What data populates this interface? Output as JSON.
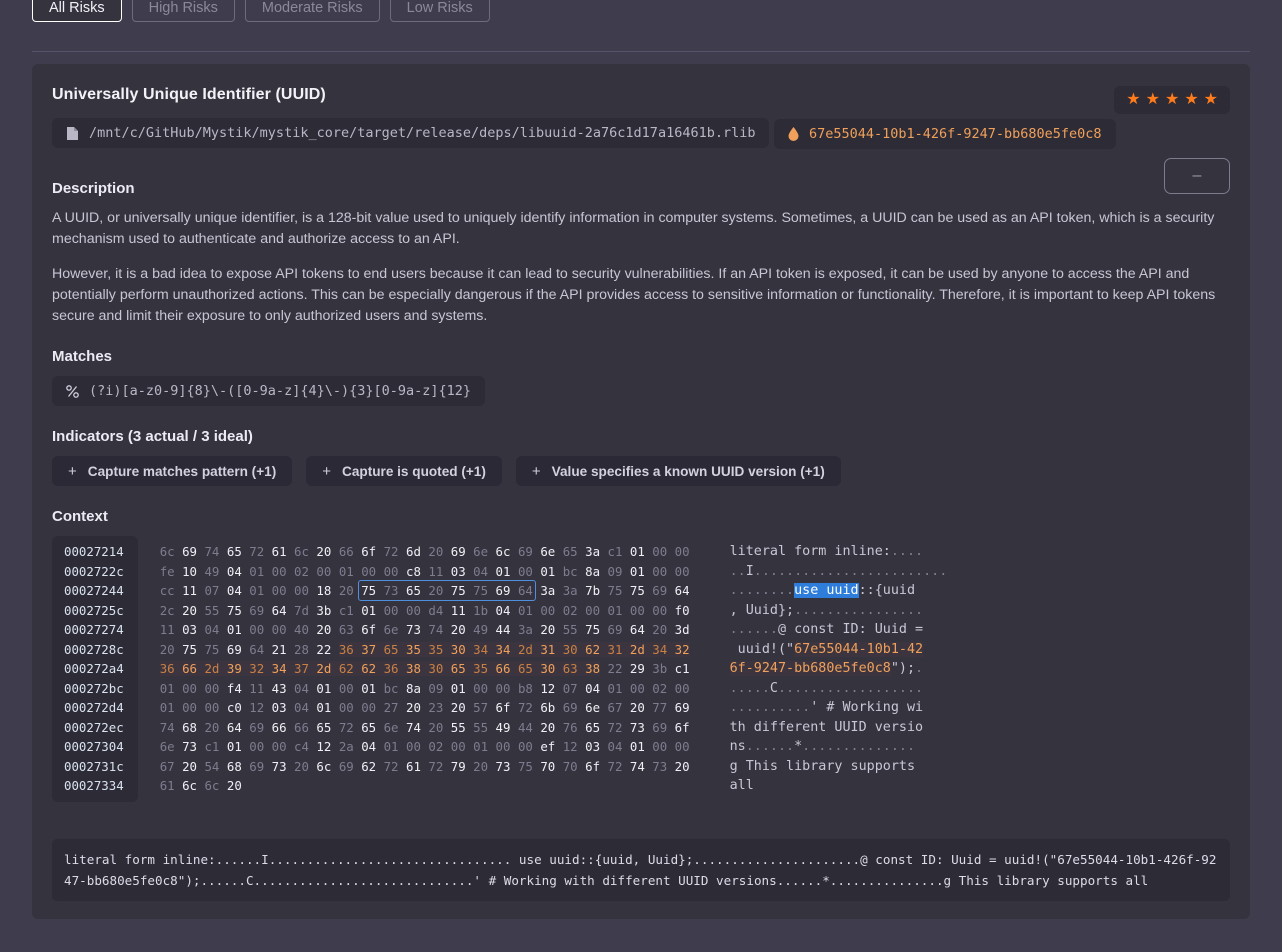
{
  "tabs": [
    {
      "label": "All Risks",
      "active": true
    },
    {
      "label": "High Risks",
      "active": false
    },
    {
      "label": "Moderate Risks",
      "active": false
    },
    {
      "label": "Low Risks",
      "active": false
    }
  ],
  "card": {
    "title": "Universally Unique Identifier (UUID)",
    "file_path": "/mnt/c/GitHub/Mystik/mystik_core/target/release/deps/libuuid-2a76c1d17a16461b.rlib",
    "hash": "67e55044-10b1-426f-9247-bb680e5fe0c8",
    "path_icon": "file-icon",
    "hash_icon": "droplet-icon",
    "rating": 5,
    "star_glyph": "★",
    "star_color": "#ff7b1c",
    "minimize_label": "–"
  },
  "description": {
    "heading": "Description",
    "paragraphs": [
      "A UUID, or universally unique identifier, is a 128-bit value used to uniquely identify information in computer systems. Sometimes, a UUID can be used as an API token, which is a security mechanism used to authenticate and authorize access to an API.",
      "However, it is a bad idea to expose API tokens to end users because it can lead to security vulnerabilities. If an API token is exposed, it can be used by anyone to access the API and potentially perform unauthorized actions. This can be especially dangerous if the API provides access to sensitive information or functionality. Therefore, it is important to keep API tokens secure and limit their exposure to only authorized users and systems."
    ]
  },
  "matches": {
    "heading": "Matches",
    "icon": "regex-icon",
    "pattern": "(?i)[a-z0-9]{8}\\-([0-9a-z]{4}\\-){3}[0-9a-z]{12}"
  },
  "indicators": {
    "heading": "Indicators (3 actual / 3 ideal)",
    "plus_glyph": "+",
    "items": [
      "Capture matches pattern (+1)",
      "Capture is quoted (+1)",
      "Value specifies a known UUID version (+1)"
    ]
  },
  "context": {
    "heading": "Context",
    "offsets": [
      "00027214",
      "0002722c",
      "00027244",
      "0002725c",
      "00027274",
      "0002728c",
      "000272a4",
      "000272bc",
      "000272d4",
      "000272ec",
      "00027304",
      "0002731c",
      "00027334"
    ],
    "rows": [
      [
        "6c",
        "69",
        "74",
        "65",
        "72",
        "61",
        "6c",
        "20",
        "66",
        "6f",
        "72",
        "6d",
        "20",
        "69",
        "6e",
        "6c",
        "69",
        "6e",
        "65",
        "3a",
        "c1",
        "01",
        "00",
        "00"
      ],
      [
        "fe",
        "10",
        "49",
        "04",
        "01",
        "00",
        "02",
        "00",
        "01",
        "00",
        "00",
        "c8",
        "11",
        "03",
        "04",
        "01",
        "00",
        "01",
        "bc",
        "8a",
        "09",
        "01",
        "00",
        "00"
      ],
      [
        "cc",
        "11",
        "07",
        "04",
        "01",
        "00",
        "00",
        "18",
        "20",
        "75",
        "73",
        "65",
        "20",
        "75",
        "75",
        "69",
        "64",
        "3a",
        "3a",
        "7b",
        "75",
        "75",
        "69",
        "64"
      ],
      [
        "2c",
        "20",
        "55",
        "75",
        "69",
        "64",
        "7d",
        "3b",
        "c1",
        "01",
        "00",
        "00",
        "d4",
        "11",
        "1b",
        "04",
        "01",
        "00",
        "02",
        "00",
        "01",
        "00",
        "00",
        "f0"
      ],
      [
        "11",
        "03",
        "04",
        "01",
        "00",
        "00",
        "40",
        "20",
        "63",
        "6f",
        "6e",
        "73",
        "74",
        "20",
        "49",
        "44",
        "3a",
        "20",
        "55",
        "75",
        "69",
        "64",
        "20",
        "3d"
      ],
      [
        "20",
        "75",
        "75",
        "69",
        "64",
        "21",
        "28",
        "22",
        "36",
        "37",
        "65",
        "35",
        "35",
        "30",
        "34",
        "34",
        "2d",
        "31",
        "30",
        "62",
        "31",
        "2d",
        "34",
        "32"
      ],
      [
        "36",
        "66",
        "2d",
        "39",
        "32",
        "34",
        "37",
        "2d",
        "62",
        "62",
        "36",
        "38",
        "30",
        "65",
        "35",
        "66",
        "65",
        "30",
        "63",
        "38",
        "22",
        "29",
        "3b",
        "c1"
      ],
      [
        "01",
        "00",
        "00",
        "f4",
        "11",
        "43",
        "04",
        "01",
        "00",
        "01",
        "bc",
        "8a",
        "09",
        "01",
        "00",
        "00",
        "b8",
        "12",
        "07",
        "04",
        "01",
        "00",
        "02",
        "00"
      ],
      [
        "01",
        "00",
        "00",
        "c0",
        "12",
        "03",
        "04",
        "01",
        "00",
        "00",
        "27",
        "20",
        "23",
        "20",
        "57",
        "6f",
        "72",
        "6b",
        "69",
        "6e",
        "67",
        "20",
        "77",
        "69"
      ],
      [
        "74",
        "68",
        "20",
        "64",
        "69",
        "66",
        "66",
        "65",
        "72",
        "65",
        "6e",
        "74",
        "20",
        "55",
        "55",
        "49",
        "44",
        "20",
        "76",
        "65",
        "72",
        "73",
        "69",
        "6f"
      ],
      [
        "6e",
        "73",
        "c1",
        "01",
        "00",
        "00",
        "c4",
        "12",
        "2a",
        "04",
        "01",
        "00",
        "02",
        "00",
        "01",
        "00",
        "00",
        "ef",
        "12",
        "03",
        "04",
        "01",
        "00",
        "00"
      ],
      [
        "67",
        "20",
        "54",
        "68",
        "69",
        "73",
        "20",
        "6c",
        "69",
        "62",
        "72",
        "61",
        "72",
        "79",
        "20",
        "73",
        "75",
        "70",
        "70",
        "6f",
        "72",
        "74",
        "73",
        "20"
      ],
      [
        "61",
        "6c",
        "6c",
        "20"
      ]
    ],
    "selection_row": 2,
    "selection_start": 9,
    "selection_end": 16,
    "orange_row_start": 5,
    "orange_start_col": 8,
    "orange_row_end": 6,
    "orange_end_col": 19,
    "ascii_lines": [
      [
        {
          "t": "literal form inline:",
          "s": "n"
        },
        {
          "t": "....",
          "s": "d"
        }
      ],
      [
        {
          "t": "..",
          "s": "d"
        },
        {
          "t": "I",
          "s": "n"
        },
        {
          "t": "........................",
          "s": "d"
        }
      ],
      [
        {
          "t": "........",
          "s": "d"
        },
        {
          "t": "use uuid",
          "s": "sel"
        },
        {
          "t": "::{uuid",
          "s": "n"
        }
      ],
      [
        {
          "t": ", Uuid};",
          "s": "n"
        },
        {
          "t": "................",
          "s": "d"
        }
      ],
      [
        {
          "t": "......",
          "s": "d"
        },
        {
          "t": "@ const ID: Uuid =",
          "s": "n"
        }
      ],
      [
        {
          "t": " uuid!(\"",
          "s": "n"
        },
        {
          "t": "67e55044-10b1-42",
          "s": "orng"
        }
      ],
      [
        {
          "t": "6f-9247-bb680e5fe0c8",
          "s": "orng"
        },
        {
          "t": "\");",
          "s": "n"
        },
        {
          "t": ".",
          "s": "d"
        }
      ],
      [
        {
          "t": ".....",
          "s": "d"
        },
        {
          "t": "C",
          "s": "n"
        },
        {
          "t": "..................",
          "s": "d"
        }
      ],
      [
        {
          "t": "..........",
          "s": "d"
        },
        {
          "t": "' # Working wi",
          "s": "n"
        }
      ],
      [
        {
          "t": "th different UUID versio",
          "s": "n"
        }
      ],
      [
        {
          "t": "ns",
          "s": "n"
        },
        {
          "t": "......",
          "s": "d"
        },
        {
          "t": "*",
          "s": "n"
        },
        {
          "t": "..............",
          "s": "d"
        }
      ],
      [
        {
          "t": "g This library supports",
          "s": "n"
        }
      ],
      [
        {
          "t": "all",
          "s": "n"
        }
      ]
    ]
  },
  "summary": {
    "text": "literal form inline:......I................................ use uuid::{uuid, Uuid};......................@ const ID: Uuid = uuid!(\"67e55044-10b1-426f-9247-bb680e5fe0c8\");......C.............................' # Working with different UUID versions......*...............g This library supports all"
  }
}
